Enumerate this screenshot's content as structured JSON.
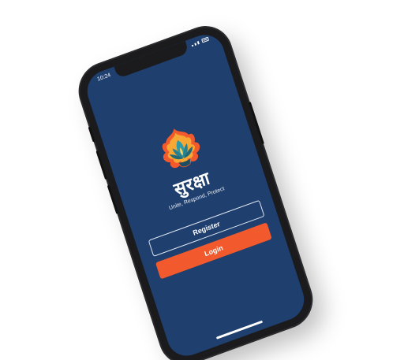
{
  "status_bar": {
    "time": "10:24"
  },
  "app": {
    "logo_icon": "flame-lotus-icon",
    "title": "सुरक्षा",
    "tagline": "Unite, Respond, Protect"
  },
  "actions": {
    "register_label": "Register",
    "login_label": "Login"
  },
  "colors": {
    "screen_background": "#1f3f6e",
    "accent": "#f25a2d",
    "text": "#ffffff"
  }
}
